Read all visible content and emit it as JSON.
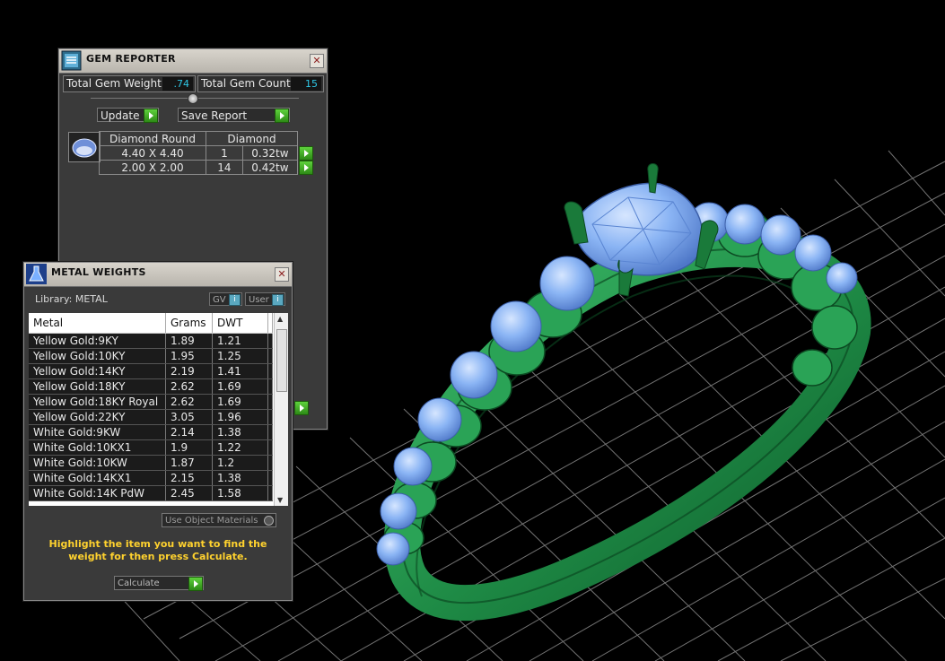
{
  "gem_reporter": {
    "title": "GEM REPORTER",
    "close": "✕",
    "total_gem_weight_label": "Total Gem Weight",
    "total_gem_weight": ".74",
    "total_gem_count_label": "Total Gem Count",
    "total_gem_count": "15",
    "update_label": "Update",
    "save_report_label": "Save Report",
    "table": {
      "header_shape": "Diamond Round",
      "header_type": "Diamond",
      "rows": [
        {
          "size": "4.40 X 4.40",
          "count": "1",
          "weight": "0.32tw"
        },
        {
          "size": "2.00 X 2.00",
          "count": "14",
          "weight": "0.42tw"
        }
      ]
    }
  },
  "metal_weights": {
    "title": "METAL WEIGHTS",
    "close": "✕",
    "library_label": "Library: METAL",
    "toggle_gv": "GV",
    "toggle_user": "User",
    "columns": [
      "Metal",
      "Grams",
      "DWT"
    ],
    "rows": [
      [
        "Yellow Gold:9KY",
        "1.89",
        "1.21"
      ],
      [
        "Yellow Gold:10KY",
        "1.95",
        "1.25"
      ],
      [
        "Yellow Gold:14KY",
        "2.19",
        "1.41"
      ],
      [
        "Yellow Gold:18KY",
        "2.62",
        "1.69"
      ],
      [
        "Yellow Gold:18KY Royal",
        "2.62",
        "1.69"
      ],
      [
        "Yellow Gold:22KY",
        "3.05",
        "1.96"
      ],
      [
        "White Gold:9KW",
        "2.14",
        "1.38"
      ],
      [
        "White Gold:10KX1",
        "1.9",
        "1.22"
      ],
      [
        "White Gold:10KW",
        "1.87",
        "1.2"
      ],
      [
        "White Gold:14KX1",
        "2.15",
        "1.38"
      ],
      [
        "White Gold:14K PdW",
        "2.45",
        "1.58"
      ]
    ],
    "use_object_materials_label": "Use Object Materials",
    "hint": "Highlight the item you want to find the weight for then press Calculate.",
    "calculate_label": "Calculate"
  },
  "colors": {
    "metal_green": "#1f8a45",
    "gem_blue": "#8ab4f4",
    "grid": "#9a9a9a",
    "hint_yellow": "#ffd22e",
    "value_cyan": "#2fc7e6"
  }
}
